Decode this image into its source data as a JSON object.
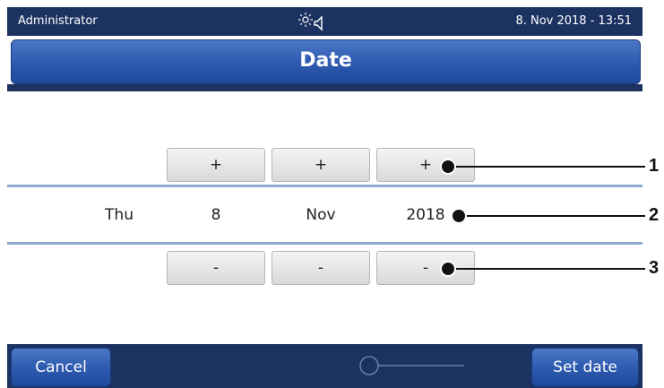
{
  "status": {
    "user": "Administrator",
    "datetime": "8. Nov 2018 - 13:51",
    "icons": [
      "brightness-icon",
      "speaker-icon"
    ]
  },
  "header": {
    "title": "Date"
  },
  "picker": {
    "plus_label": "+",
    "minus_label": "-",
    "fields": [
      {
        "name": "weekday",
        "value": "Thu"
      },
      {
        "name": "day",
        "value": "8"
      },
      {
        "name": "month",
        "value": "Nov"
      },
      {
        "name": "year",
        "value": "2018"
      }
    ]
  },
  "footer": {
    "cancel_label": "Cancel",
    "set_label": "Set date"
  },
  "callouts": [
    "1",
    "2",
    "3"
  ],
  "colors": {
    "status_bg": "#1c3261",
    "title_blue": "#2e5bb0",
    "divider": "#8fa9d6"
  }
}
